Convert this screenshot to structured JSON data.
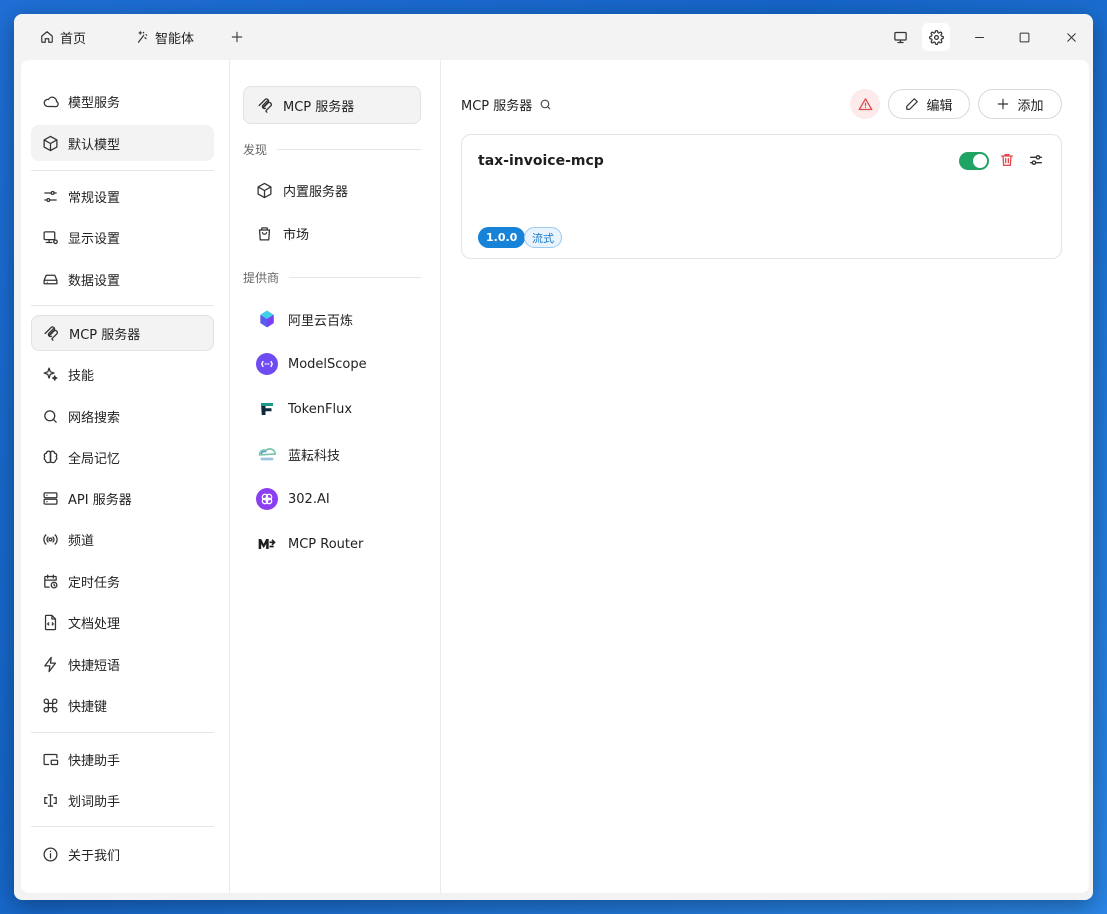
{
  "titlebar": {
    "tabs": [
      {
        "label": "首页",
        "icon": "home-icon"
      },
      {
        "label": "智能体",
        "icon": "sparkle-icon"
      }
    ],
    "add_tab_icon": "plus-icon",
    "buttons": [
      "monitor-icon",
      "gear-icon",
      "minimize-icon",
      "maximize-icon",
      "close-icon"
    ]
  },
  "sidebar": {
    "items": [
      {
        "label": "模型服务",
        "icon": "cloud-icon"
      },
      {
        "label": "默认模型",
        "icon": "cube-icon"
      },
      {
        "label": "常规设置",
        "icon": "sliders-icon"
      },
      {
        "label": "显示设置",
        "icon": "display-icon"
      },
      {
        "label": "数据设置",
        "icon": "drive-icon"
      },
      {
        "label": "MCP 服务器",
        "icon": "mcp-icon"
      },
      {
        "label": "技能",
        "icon": "sparkles-icon"
      },
      {
        "label": "网络搜索",
        "icon": "search-icon"
      },
      {
        "label": "全局记忆",
        "icon": "brain-icon"
      },
      {
        "label": "API 服务器",
        "icon": "server-icon"
      },
      {
        "label": "频道",
        "icon": "radio-icon"
      },
      {
        "label": "定时任务",
        "icon": "calendar-clock-icon"
      },
      {
        "label": "文档处理",
        "icon": "file-code-icon"
      },
      {
        "label": "快捷短语",
        "icon": "zap-icon"
      },
      {
        "label": "快捷键",
        "icon": "command-icon"
      },
      {
        "label": "快捷助手",
        "icon": "picture-in-picture-icon"
      },
      {
        "label": "划词助手",
        "icon": "text-select-icon"
      },
      {
        "label": "关于我们",
        "icon": "info-icon"
      }
    ],
    "active": "MCP 服务器"
  },
  "middle": {
    "header": "MCP 服务器",
    "discover_title": "发现",
    "discover_items": [
      {
        "label": "内置服务器",
        "icon": "package-icon"
      },
      {
        "label": "市场",
        "icon": "shopping-bag-icon"
      }
    ],
    "providers_title": "提供商",
    "providers": [
      {
        "label": "阿里云百炼",
        "icon": "bailian-logo-icon"
      },
      {
        "label": "ModelScope",
        "icon": "modelscope-logo-icon"
      },
      {
        "label": "TokenFlux",
        "icon": "tokenflux-logo-icon"
      },
      {
        "label": "蓝耘科技",
        "icon": "lanyun-logo-icon"
      },
      {
        "label": "302.AI",
        "icon": "302ai-logo-icon"
      },
      {
        "label": "MCP Router",
        "icon": "mcp-router-logo-icon"
      }
    ]
  },
  "main": {
    "title": "MCP 服务器",
    "edit_label": "编辑",
    "add_label": "添加",
    "servers": [
      {
        "name": "tax-invoice-mcp",
        "version": "1.0.0",
        "type": "流式",
        "enabled": true
      }
    ]
  },
  "colors": {
    "accent_green": "#1fa463",
    "badge_blue": "#1683d8",
    "danger": "#e5484d"
  }
}
